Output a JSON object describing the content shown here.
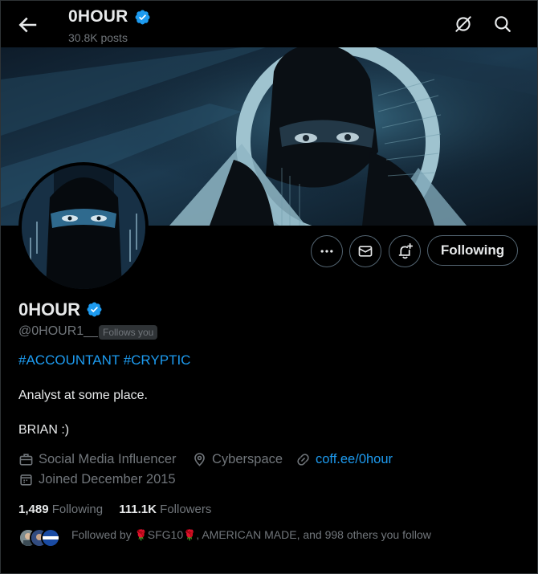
{
  "header": {
    "title": "0HOUR",
    "posts_count": "30.8K posts"
  },
  "icons": {
    "back": "arrow-left-icon",
    "grok": "grok-slash-circle-icon",
    "search": "search-icon",
    "verified": "verified-badge-icon",
    "more": "more-dots-icon",
    "message": "envelope-icon",
    "notify": "bell-plus-icon",
    "briefcase": "briefcase-icon",
    "location": "location-pin-icon",
    "link": "link-icon",
    "calendar": "calendar-icon"
  },
  "actions": {
    "following_label": "Following"
  },
  "profile": {
    "display_name": "0HOUR",
    "handle": "@0HOUR1__",
    "follows_you": "Follows you",
    "hashtag1": "#ACCOUNTANT",
    "hashtag2": "#CRYPTIC",
    "bio_line1": "Analyst at some place.",
    "bio_line2": "BRIAN :)",
    "category": "Social Media Influencer",
    "location": "Cyberspace",
    "website": "coff.ee/0hour",
    "joined": "Joined December 2015"
  },
  "stats": {
    "following_count": "1,489",
    "following_label": "Following",
    "followers_count": "111.1K",
    "followers_label": "Followers"
  },
  "followed_by": {
    "prefix": "Followed by ",
    "name1": "SFG10",
    "suffix": ", AMERICAN MADE, and 998 others you follow",
    "rose": "🌹"
  },
  "colors": {
    "accent": "#1d9bf0",
    "background": "#000000",
    "muted": "#71767b",
    "text": "#e7e9ea"
  }
}
